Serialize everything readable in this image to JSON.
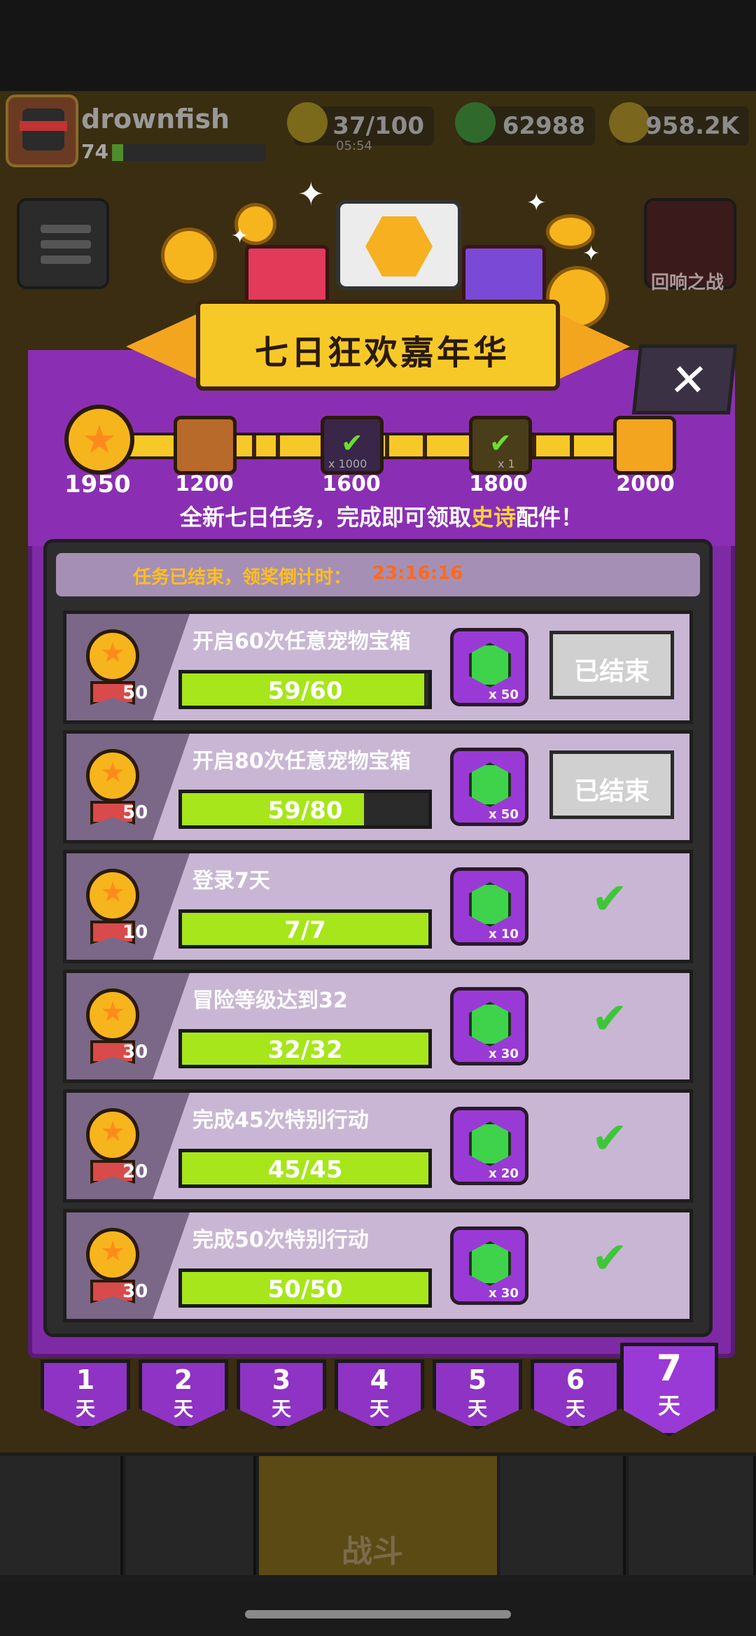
{
  "player": {
    "name": "drownfish",
    "level": "74"
  },
  "resources": {
    "energy": "37/100",
    "energy_timer": "05:54",
    "gems": "62988",
    "coins": "958.2K"
  },
  "side_buttons": {
    "event_label": "回响之战"
  },
  "bottom_nav": {
    "battle_label": "战斗"
  },
  "event": {
    "title": "七日狂欢嘉年华",
    "close_symbol": "✕",
    "total_points": "1950",
    "milestones": [
      {
        "points": "1200",
        "state": "chest"
      },
      {
        "points": "1600",
        "state": "claimed",
        "mult": "x 1000"
      },
      {
        "points": "1800",
        "state": "claimed",
        "mult": "x 1"
      },
      {
        "points": "2000",
        "state": "chest"
      }
    ],
    "subtitle_pre": "全新七日任务，完成即可领取",
    "subtitle_highlight": "史诗",
    "subtitle_post": "配件！",
    "timer_label": "任务已结束，领奖倒计时：",
    "timer_value": "23:16:16",
    "ended_label": "已结束",
    "colors": {
      "panel": "#7f2aa5",
      "progress_fill": "#a6e61a",
      "highlight": "#ffd23a",
      "countdown": "#ff6a1a"
    },
    "tasks": [
      {
        "name": "开启60次任意宠物宝箱",
        "points": "50",
        "progress": "59/60",
        "fraction": 0.9833,
        "reward_qty": "x 50",
        "status": "ended"
      },
      {
        "name": "开启80次任意宠物宝箱",
        "points": "50",
        "progress": "59/80",
        "fraction": 0.7375,
        "reward_qty": "x 50",
        "status": "ended"
      },
      {
        "name": "登录7天",
        "points": "10",
        "progress": "7/7",
        "fraction": 1.0,
        "reward_qty": "x 10",
        "status": "done"
      },
      {
        "name": "冒险等级达到32",
        "points": "30",
        "progress": "32/32",
        "fraction": 1.0,
        "reward_qty": "x 30",
        "status": "done"
      },
      {
        "name": "完成45次特别行动",
        "points": "20",
        "progress": "45/45",
        "fraction": 1.0,
        "reward_qty": "x 20",
        "status": "done"
      },
      {
        "name": "完成50次特别行动",
        "points": "30",
        "progress": "50/50",
        "fraction": 1.0,
        "reward_qty": "x 30",
        "status": "done"
      }
    ],
    "days": [
      {
        "n": "1",
        "t": "天"
      },
      {
        "n": "2",
        "t": "天"
      },
      {
        "n": "3",
        "t": "天"
      },
      {
        "n": "4",
        "t": "天"
      },
      {
        "n": "5",
        "t": "天"
      },
      {
        "n": "6",
        "t": "天"
      },
      {
        "n": "7",
        "t": "天",
        "active": true
      }
    ]
  }
}
